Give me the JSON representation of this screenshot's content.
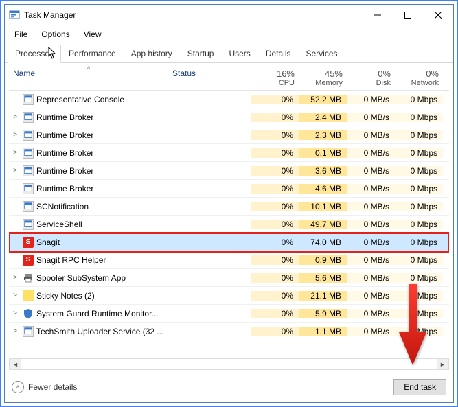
{
  "window": {
    "title": "Task Manager"
  },
  "menu": {
    "file": "File",
    "options": "Options",
    "view": "View"
  },
  "tabs": [
    {
      "id": "processes",
      "label": "Processes",
      "active": true
    },
    {
      "id": "performance",
      "label": "Performance"
    },
    {
      "id": "apphistory",
      "label": "App history"
    },
    {
      "id": "startup",
      "label": "Startup"
    },
    {
      "id": "users",
      "label": "Users"
    },
    {
      "id": "details",
      "label": "Details"
    },
    {
      "id": "services",
      "label": "Services"
    }
  ],
  "columns": {
    "name": "Name",
    "status": "Status",
    "cpu": {
      "pct": "16%",
      "label": "CPU"
    },
    "memory": {
      "pct": "45%",
      "label": "Memory"
    },
    "disk": {
      "pct": "0%",
      "label": "Disk"
    },
    "network": {
      "pct": "0%",
      "label": "Network"
    }
  },
  "processes": [
    {
      "expand": "",
      "icon": "generic",
      "name": "Representative Console",
      "cpu": "0%",
      "mem": "52.2 MB",
      "disk": "0 MB/s",
      "net": "0 Mbps"
    },
    {
      "expand": ">",
      "icon": "generic",
      "name": "Runtime Broker",
      "cpu": "0%",
      "mem": "2.4 MB",
      "disk": "0 MB/s",
      "net": "0 Mbps"
    },
    {
      "expand": ">",
      "icon": "generic",
      "name": "Runtime Broker",
      "cpu": "0%",
      "mem": "2.3 MB",
      "disk": "0 MB/s",
      "net": "0 Mbps"
    },
    {
      "expand": ">",
      "icon": "generic",
      "name": "Runtime Broker",
      "cpu": "0%",
      "mem": "0.1 MB",
      "disk": "0 MB/s",
      "net": "0 Mbps"
    },
    {
      "expand": ">",
      "icon": "generic",
      "name": "Runtime Broker",
      "cpu": "0%",
      "mem": "3.6 MB",
      "disk": "0 MB/s",
      "net": "0 Mbps"
    },
    {
      "expand": "",
      "icon": "generic",
      "name": "Runtime Broker",
      "cpu": "0%",
      "mem": "4.6 MB",
      "disk": "0 MB/s",
      "net": "0 Mbps"
    },
    {
      "expand": "",
      "icon": "generic",
      "name": "SCNotification",
      "cpu": "0%",
      "mem": "10.1 MB",
      "disk": "0 MB/s",
      "net": "0 Mbps"
    },
    {
      "expand": "",
      "icon": "generic",
      "name": "ServiceShell",
      "cpu": "0%",
      "mem": "49.7 MB",
      "disk": "0 MB/s",
      "net": "0 Mbps"
    },
    {
      "expand": "",
      "icon": "snagit",
      "name": "Snagit",
      "cpu": "0%",
      "mem": "74.0 MB",
      "disk": "0 MB/s",
      "net": "0 Mbps",
      "selected": true,
      "highlighted": true
    },
    {
      "expand": "",
      "icon": "snagit",
      "name": "Snagit RPC Helper",
      "cpu": "0%",
      "mem": "0.9 MB",
      "disk": "0 MB/s",
      "net": "0 Mbps"
    },
    {
      "expand": ">",
      "icon": "printer",
      "name": "Spooler SubSystem App",
      "cpu": "0%",
      "mem": "5.6 MB",
      "disk": "0 MB/s",
      "net": "0 Mbps"
    },
    {
      "expand": ">",
      "icon": "sticky",
      "name": "Sticky Notes (2)",
      "cpu": "0%",
      "mem": "21.1 MB",
      "disk": "0 MB/s",
      "net": "0 Mbps"
    },
    {
      "expand": ">",
      "icon": "shield",
      "name": "System Guard Runtime Monitor...",
      "cpu": "0%",
      "mem": "5.9 MB",
      "disk": "0 MB/s",
      "net": "Mbps"
    },
    {
      "expand": ">",
      "icon": "generic",
      "name": "TechSmith Uploader Service (32 ...",
      "cpu": "0%",
      "mem": "1.1 MB",
      "disk": "0 MB/s",
      "net": "Mbps"
    }
  ],
  "footer": {
    "fewer": "Fewer details",
    "end_task": "End task"
  }
}
